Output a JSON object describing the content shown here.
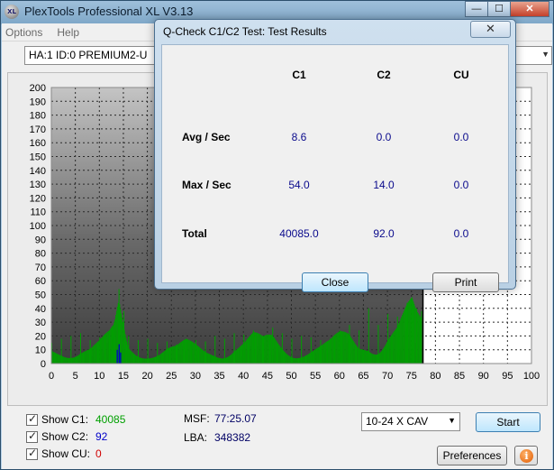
{
  "app": {
    "title": "PlexTools Professional XL V3.13",
    "logo_text": "XL",
    "window_buttons": {
      "minimize": "—",
      "maximize": "☐",
      "close": "✕"
    }
  },
  "menu": {
    "items": [
      "Options",
      "Help"
    ]
  },
  "drive": {
    "selected": "HA:1 ID:0  PREMIUM2-U"
  },
  "chart_data": {
    "type": "bar",
    "xlim": [
      0,
      100
    ],
    "ylim": [
      0,
      200
    ],
    "x_ticks": [
      0,
      5,
      10,
      15,
      20,
      25,
      30,
      35,
      40,
      45,
      50,
      55,
      60,
      65,
      70,
      75,
      80,
      85,
      90,
      95,
      100
    ],
    "y_ticks": [
      0,
      10,
      20,
      30,
      40,
      50,
      60,
      70,
      80,
      90,
      100,
      110,
      120,
      130,
      140,
      150,
      160,
      170,
      180,
      190,
      200
    ],
    "scan_end_minute": 77.4,
    "grid": true,
    "series": [
      {
        "name": "C1",
        "color": "#00a000",
        "x": [
          0,
          2,
          4,
          6,
          8,
          10,
          12,
          13,
          14,
          15,
          16,
          18,
          20,
          22,
          24,
          26,
          28,
          30,
          32,
          34,
          36,
          38,
          40,
          42,
          44,
          46,
          48,
          50,
          52,
          54,
          56,
          58,
          60,
          62,
          64,
          66,
          68,
          70,
          72,
          74,
          75,
          76,
          77
        ],
        "y": [
          15,
          18,
          20,
          22,
          17,
          19,
          24,
          30,
          54,
          38,
          20,
          17,
          18,
          15,
          16,
          14,
          18,
          17,
          16,
          20,
          18,
          22,
          21,
          24,
          20,
          26,
          22,
          18,
          20,
          19,
          17,
          18,
          24,
          28,
          24,
          40,
          28,
          36,
          34,
          44,
          48,
          40,
          38
        ]
      },
      {
        "name": "C2",
        "color": "#0000c8",
        "x": [
          13.6,
          14.0,
          14.3
        ],
        "y": [
          10,
          14,
          8
        ]
      }
    ]
  },
  "controls": {
    "show_c1": {
      "label": "Show C1:",
      "value": "40085",
      "color": "#00a000"
    },
    "show_c2": {
      "label": "Show C2:",
      "value": "92",
      "color": "#0000c8"
    },
    "show_cu": {
      "label": "Show CU:",
      "value": "0",
      "color": "#d00000"
    },
    "msf_label": "MSF:",
    "msf_value": "77:25.07",
    "lba_label": "LBA:",
    "lba_value": "348382",
    "speed": "10-24 X CAV",
    "start_label": "Start",
    "preferences_label": "Preferences",
    "info_glyph": "i"
  },
  "dialog": {
    "title": "Q-Check C1/C2 Test: Test Results",
    "close_glyph": "✕",
    "columns": [
      "C1",
      "C2",
      "CU"
    ],
    "rows": [
      {
        "label": "Avg / Sec",
        "values": [
          "8.6",
          "0.0",
          "0.0"
        ]
      },
      {
        "label": "Max / Sec",
        "values": [
          "54.0",
          "14.0",
          "0.0"
        ]
      },
      {
        "label": "Total",
        "values": [
          "40085.0",
          "92.0",
          "0.0"
        ]
      }
    ],
    "close_label": "Close",
    "print_label": "Print"
  }
}
